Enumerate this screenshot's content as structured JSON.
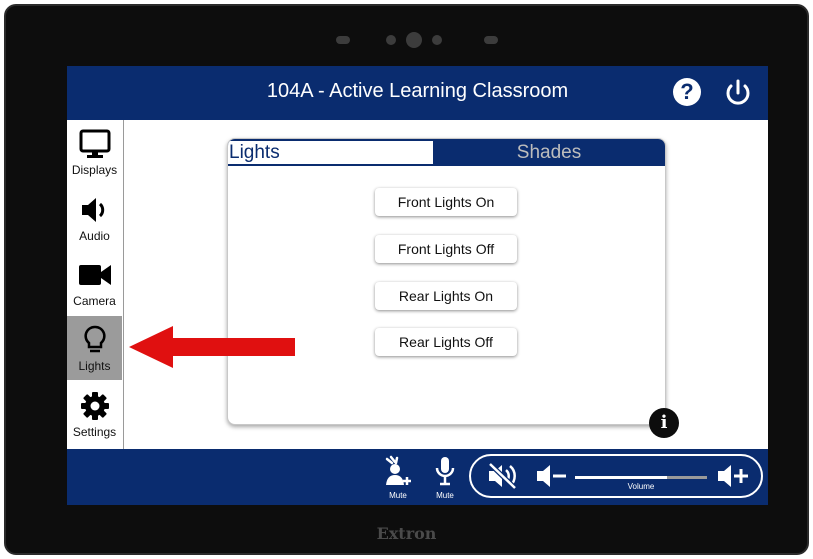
{
  "device": {
    "brand": "Extron"
  },
  "header": {
    "title": "104A - Active Learning Classroom",
    "help_icon": "question-icon",
    "power_icon": "power-icon"
  },
  "sidebar": {
    "items": [
      {
        "label": "Displays",
        "icon": "monitor-icon",
        "active": false
      },
      {
        "label": "Audio",
        "icon": "speaker-icon",
        "active": false
      },
      {
        "label": "Camera",
        "icon": "video-camera-icon",
        "active": false
      },
      {
        "label": "Lights",
        "icon": "lightbulb-icon",
        "active": true
      },
      {
        "label": "Settings",
        "icon": "gear-icon",
        "active": false
      }
    ]
  },
  "panel": {
    "tabs": [
      {
        "label": "Lights",
        "active": true
      },
      {
        "label": "Shades",
        "active": false
      }
    ],
    "buttons": [
      {
        "label": "Front Lights On"
      },
      {
        "label": "Front Lights Off"
      },
      {
        "label": "Rear Lights On"
      },
      {
        "label": "Rear Lights Off"
      }
    ],
    "info_icon": "info-icon"
  },
  "footer": {
    "mute_buttons": [
      {
        "label": "Mute",
        "icon": "presenter-mute-icon"
      },
      {
        "label": "Mute",
        "icon": "microphone-icon"
      }
    ],
    "volume": {
      "label": "Volume",
      "level": 0.7,
      "mute_icon": "speaker-muted-icon",
      "down_icon": "volume-down-icon",
      "up_icon": "volume-up-icon"
    }
  },
  "annotation": {
    "icon": "red-arrow-icon",
    "color": "#e01010"
  },
  "colors": {
    "accent": "#0a2c6f",
    "active_tab_bg": "#9b9b9b"
  }
}
